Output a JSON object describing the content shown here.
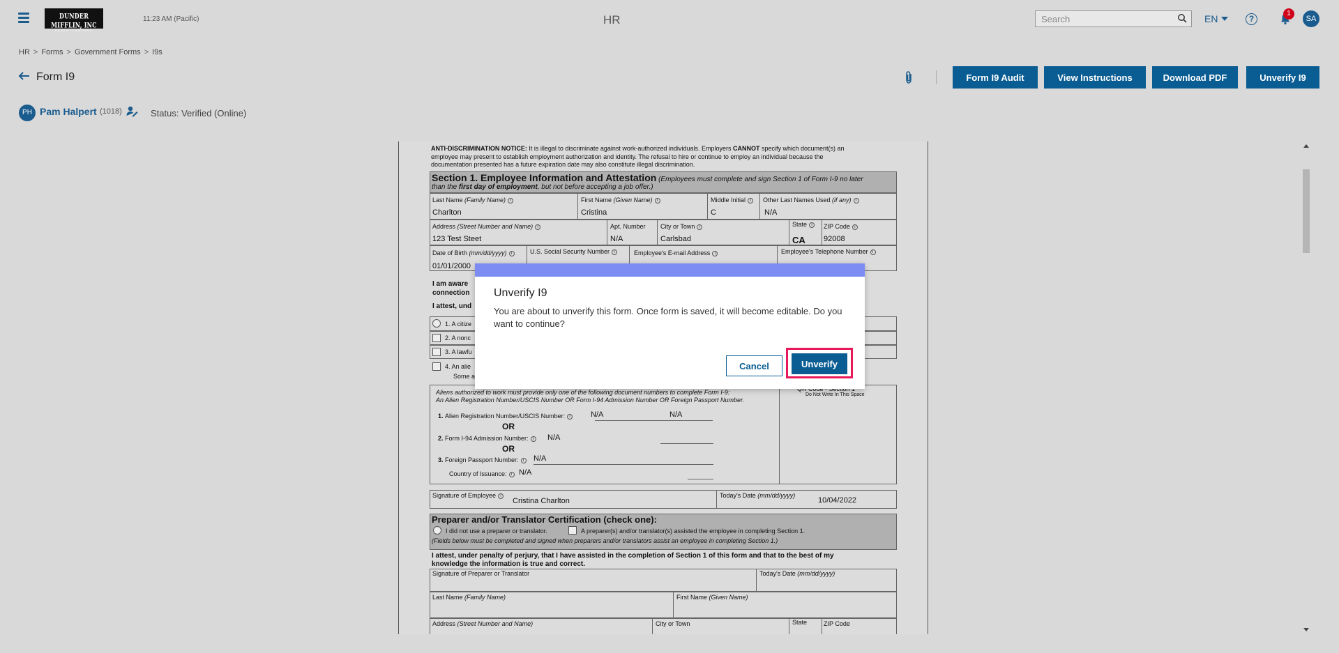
{
  "topbar": {
    "logo_line1": "DUNDER MIFFLIN, INC",
    "logo_line2": "PAPER COMPANY",
    "clock": "11:23 AM (Pacific)",
    "app_title": "HR",
    "search_placeholder": "Search",
    "language": "EN",
    "notification_count": "1",
    "user_initials": "SA"
  },
  "breadcrumb": [
    "HR",
    "Forms",
    "Government Forms",
    "I9s"
  ],
  "header": {
    "title": "Form I9",
    "actions": [
      "Form I9 Audit",
      "View Instructions",
      "Download PDF",
      "Unverify I9"
    ]
  },
  "employee": {
    "initials": "PH",
    "name": "Pam Halpert",
    "id": "(1018)",
    "status": "Status: Verified (Online)"
  },
  "form": {
    "notice_bold": "ANTI-DISCRIMINATION NOTICE:",
    "notice_line1": " It is illegal to discriminate against work-authorized individuals. Employers ",
    "notice_cannot": "CANNOT",
    "notice_line1b": " specify which document(s) an",
    "notice_line2": "employee may present to establish employment authorization and identity. The refusal to hire or continue to employ an individual because the",
    "notice_line3": "documentation presented has a future expiration date may also constitute illegal discrimination.",
    "section1_title": "Section 1. Employee Information and Attestation",
    "section1_note1": " (Employees must complete and sign Section 1 of Form I-9 no later",
    "section1_note2a": "than the ",
    "section1_note2b": "first day of employment",
    "section1_note2c": ", but not before accepting a job offer.)",
    "labels": {
      "last_name": "Last Name",
      "last_name_hint": " (Family Name)",
      "first_name": "First Name",
      "first_name_hint": " (Given Name)",
      "middle_initial": "Middle Initial",
      "other_last_names": "Other Last Names Used",
      "other_last_names_hint": " (if any)",
      "address": "Address",
      "address_hint": " (Street Number and Name)",
      "apt": "Apt. Number",
      "city": "City or Town",
      "state": "State",
      "zip": "ZIP Code",
      "dob": "Date of Birth",
      "dob_hint": " (mm/dd/yyyy)",
      "ssn": "U.S. Social Security Number",
      "email": "Employee's E-mail Address",
      "phone": "Employee's Telephone Number"
    },
    "values": {
      "last_name": "Charlton",
      "first_name": "Cristina",
      "middle_initial": "C",
      "other_last_names": "N/A",
      "address": "123 Test Steet",
      "apt": "N/A",
      "city": "Carlsbad",
      "state": "CA",
      "zip": "92008",
      "dob": "01/01/2000"
    },
    "attest_1": "I am aware",
    "attest_2": "connection",
    "attest_3": "I attest, und",
    "options": [
      "1. A citize",
      "2. A nonc",
      "3. A lawfu",
      "4. An alie"
    ],
    "option4_sub": "Some a",
    "aliens_note1": "Aliens authorized to work must provide only one of the following document numbers to complete Form I-9:",
    "aliens_note2": "An Alien Registration Number/USCIS Number OR Form I-94 Admission Number OR Foreign Passport Number.",
    "alien_reg_label": "Alien Registration Number/USCIS Number:",
    "alien_reg_value": "N/A",
    "alien_reg_value2": "N/A",
    "or": "OR",
    "i94_label": "Form I-94 Admission Number:",
    "i94_value": "N/A",
    "passport_label": "Foreign Passport Number:",
    "passport_value": "N/A",
    "country_label": "Country of Issuance:",
    "country_value": "N/A",
    "qr_note1": "QR Code - Section 1",
    "qr_note2": "Do Not Write In This Space",
    "signature_label": "Signature of Employee",
    "signature_value": "Cristina Charlton",
    "today_label": "Today's Date",
    "today_hint": " (mm/dd/yyyy)",
    "today_value": "10/04/2022",
    "preparer_title": "Preparer and/or Translator Certification (check one):",
    "preparer_opt1": "I did not use a preparer or translator.",
    "preparer_opt2": "A preparer(s) and/or translator(s) assisted the employee in completing Section 1.",
    "preparer_note": "(Fields below must be completed and signed when preparers and/or translators assist an employee in completing Section 1.)",
    "preparer_attest1": "I attest, under penalty of perjury, that I have assisted in the completion of Section 1 of this form and that to the best of my",
    "preparer_attest2": "knowledge the information is true and correct.",
    "prep_sig_label": "Signature of Preparer or Translator",
    "prep_date_label": "Today's Date",
    "prep_date_hint": " (mm/dd/yyyy)",
    "prep_last_label": "Last Name",
    "prep_last_hint": " (Family Name)",
    "prep_first_label": "First Name",
    "prep_first_hint": " (Given Name)",
    "prep_addr_label": "Address",
    "prep_addr_hint": " (Street Number and Name)",
    "prep_city_label": "City or Town",
    "prep_state_label": "State",
    "prep_zip_label": "ZIP Code"
  },
  "modal": {
    "title": "Unverify I9",
    "body": "You are about to unverify this form. Once form is saved, it will become editable. Do you want to continue?",
    "cancel": "Cancel",
    "confirm": "Unverify"
  },
  "colors": {
    "primary": "#0a5d93",
    "modal_bar": "#7c8cf2",
    "highlight": "#e6195a",
    "badge": "#d0021b"
  }
}
